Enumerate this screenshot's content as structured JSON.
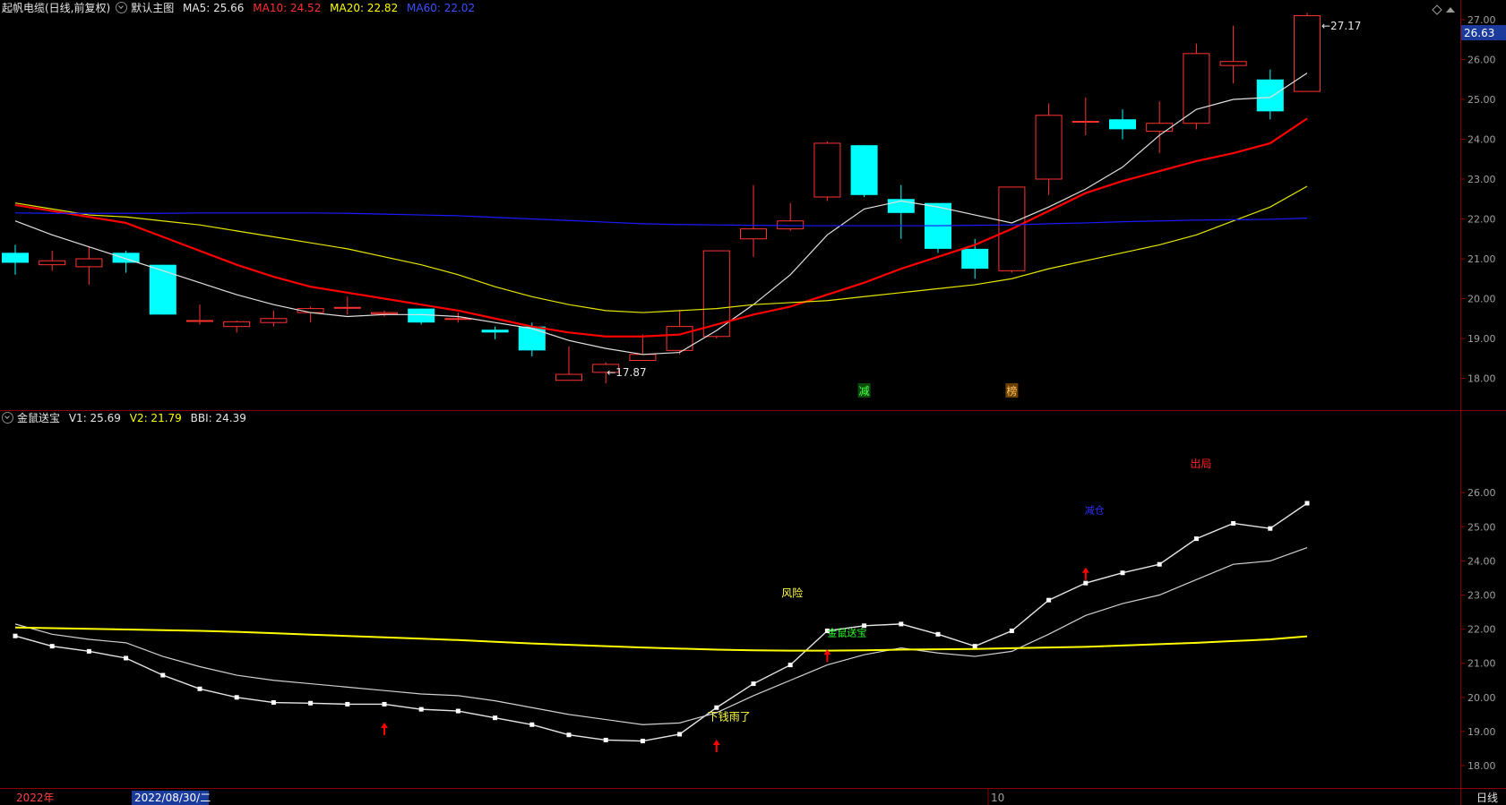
{
  "header": {
    "stock": "起帆电缆(日线,前复权)",
    "main_view": "默认主图",
    "ma5": "MA5: 25.66",
    "ma10": "MA10: 24.52",
    "ma20": "MA20: 22.82",
    "ma60": "MA60: 22.02"
  },
  "indicator_header": {
    "name": "金鼠送宝",
    "v1": "V1: 25.69",
    "v2": "V2: 21.79",
    "bbi": "BBI: 24.39"
  },
  "price_badge": "26.63",
  "high_label": "27.17",
  "low_label": "17.87",
  "markers": {
    "jian": "减",
    "bang": "榜"
  },
  "signals": {
    "xiaqian": "下钱雨了",
    "fengxian": "风险",
    "jinshu": "金鼠送宝",
    "jiancang": "减仓",
    "chuju": "出局"
  },
  "bottom_axis": {
    "year": "2022年",
    "cursor_date": "2022/08/30/二",
    "month": "10",
    "period": "日线"
  },
  "colors": {
    "up": "#ff3232",
    "down": "#00ffff",
    "ma5": "#ffffff",
    "ma10": "#ff0000",
    "ma20": "#ffff00",
    "ma60": "#0000ff"
  },
  "chart_data": [
    {
      "type": "candlestick",
      "title": "起帆电缆(日线,前复权)",
      "ylim": [
        17.6,
        27.3
      ],
      "y_ticks": [
        18,
        19,
        20,
        21,
        22,
        23,
        24,
        25,
        26,
        27
      ],
      "candles": [
        {
          "o": 21.15,
          "c": 20.9,
          "h": 21.35,
          "l": 20.6
        },
        {
          "o": 20.85,
          "c": 20.95,
          "h": 21.2,
          "l": 20.7
        },
        {
          "o": 20.8,
          "c": 21.0,
          "h": 21.3,
          "l": 20.35
        },
        {
          "o": 21.15,
          "c": 20.9,
          "h": 21.2,
          "l": 20.65
        },
        {
          "o": 20.85,
          "c": 19.6,
          "h": 20.85,
          "l": 19.6
        },
        {
          "o": 19.45,
          "c": 19.45,
          "h": 19.85,
          "l": 19.35
        },
        {
          "o": 19.3,
          "c": 19.42,
          "h": 19.45,
          "l": 19.15
        },
        {
          "o": 19.4,
          "c": 19.5,
          "h": 19.7,
          "l": 19.3
        },
        {
          "o": 19.65,
          "c": 19.75,
          "h": 19.8,
          "l": 19.4
        },
        {
          "o": 19.78,
          "c": 19.78,
          "h": 20.05,
          "l": 19.6
        },
        {
          "o": 19.62,
          "c": 19.65,
          "h": 19.7,
          "l": 19.55
        },
        {
          "o": 19.75,
          "c": 19.4,
          "h": 19.75,
          "l": 19.35
        },
        {
          "o": 19.5,
          "c": 19.5,
          "h": 19.65,
          "l": 19.4
        },
        {
          "o": 19.22,
          "c": 19.15,
          "h": 19.3,
          "l": 18.98
        },
        {
          "o": 19.3,
          "c": 18.7,
          "h": 19.4,
          "l": 18.55
        },
        {
          "o": 17.95,
          "c": 18.1,
          "h": 18.8,
          "l": 17.95
        },
        {
          "o": 18.15,
          "c": 18.35,
          "h": 18.4,
          "l": 17.87
        },
        {
          "o": 18.45,
          "c": 18.6,
          "h": 19.1,
          "l": 18.45
        },
        {
          "o": 18.7,
          "c": 19.3,
          "h": 19.7,
          "l": 18.6
        },
        {
          "o": 19.05,
          "c": 21.2,
          "h": 21.2,
          "l": 19.0
        },
        {
          "o": 21.5,
          "c": 21.75,
          "h": 22.85,
          "l": 21.05
        },
        {
          "o": 21.75,
          "c": 21.95,
          "h": 22.4,
          "l": 21.7
        },
        {
          "o": 22.55,
          "c": 23.9,
          "h": 23.95,
          "l": 22.45
        },
        {
          "o": 23.85,
          "c": 22.6,
          "h": 23.85,
          "l": 22.55
        },
        {
          "o": 22.5,
          "c": 22.15,
          "h": 22.85,
          "l": 21.5
        },
        {
          "o": 22.4,
          "c": 21.25,
          "h": 22.4,
          "l": 21.15
        },
        {
          "o": 21.25,
          "c": 20.75,
          "h": 21.5,
          "l": 20.5
        },
        {
          "o": 20.7,
          "c": 22.8,
          "h": 22.8,
          "l": 20.65
        },
        {
          "o": 23.0,
          "c": 24.6,
          "h": 24.9,
          "l": 22.6
        },
        {
          "o": 24.45,
          "c": 24.45,
          "h": 25.05,
          "l": 24.1
        },
        {
          "o": 24.5,
          "c": 24.25,
          "h": 24.75,
          "l": 24.0
        },
        {
          "o": 24.2,
          "c": 24.4,
          "h": 24.95,
          "l": 23.65
        },
        {
          "o": 24.4,
          "c": 26.15,
          "h": 26.4,
          "l": 24.25
        },
        {
          "o": 25.85,
          "c": 25.95,
          "h": 26.85,
          "l": 25.4
        },
        {
          "o": 25.5,
          "c": 24.7,
          "h": 25.75,
          "l": 24.5
        },
        {
          "o": 25.2,
          "c": 27.1,
          "h": 27.17,
          "l": 25.2
        }
      ],
      "series": [
        {
          "name": "MA5",
          "values": [
            21.95,
            21.6,
            21.3,
            21.0,
            20.7,
            20.4,
            20.1,
            19.85,
            19.65,
            19.55,
            19.6,
            19.6,
            19.55,
            19.4,
            19.25,
            18.95,
            18.75,
            18.6,
            18.65,
            19.2,
            19.85,
            20.6,
            21.6,
            22.25,
            22.45,
            22.3,
            22.1,
            21.9,
            22.3,
            22.75,
            23.3,
            24.1,
            24.75,
            25.0,
            25.05,
            25.66
          ]
        },
        {
          "name": "MA10",
          "values": [
            22.35,
            22.2,
            22.05,
            21.9,
            21.55,
            21.2,
            20.85,
            20.55,
            20.3,
            20.15,
            20.0,
            19.85,
            19.7,
            19.5,
            19.3,
            19.15,
            19.05,
            19.05,
            19.1,
            19.35,
            19.6,
            19.8,
            20.1,
            20.4,
            20.75,
            21.05,
            21.35,
            21.75,
            22.2,
            22.65,
            22.95,
            23.2,
            23.45,
            23.65,
            23.9,
            24.52
          ]
        },
        {
          "name": "MA20",
          "values": [
            22.4,
            22.25,
            22.1,
            22.05,
            21.95,
            21.85,
            21.7,
            21.55,
            21.4,
            21.25,
            21.05,
            20.85,
            20.6,
            20.3,
            20.05,
            19.85,
            19.7,
            19.65,
            19.7,
            19.75,
            19.85,
            19.9,
            19.95,
            20.05,
            20.15,
            20.25,
            20.35,
            20.5,
            20.75,
            20.95,
            21.15,
            21.35,
            21.6,
            21.95,
            22.3,
            22.82
          ]
        },
        {
          "name": "MA60",
          "values": [
            22.15,
            22.14,
            22.14,
            22.14,
            22.14,
            22.15,
            22.15,
            22.15,
            22.15,
            22.14,
            22.12,
            22.1,
            22.08,
            22.04,
            22.0,
            21.96,
            21.92,
            21.88,
            21.86,
            21.85,
            21.84,
            21.83,
            21.83,
            21.83,
            21.83,
            21.83,
            21.84,
            21.85,
            21.88,
            21.9,
            21.93,
            21.95,
            21.97,
            21.98,
            21.99,
            22.02
          ]
        }
      ]
    },
    {
      "type": "line",
      "title": "金鼠送宝",
      "ylim": [
        17.6,
        27.6
      ],
      "y_ticks": [
        18,
        19,
        20,
        21,
        22,
        23,
        24,
        25,
        26
      ],
      "series": [
        {
          "name": "V1",
          "values": [
            21.8,
            21.5,
            21.35,
            21.15,
            20.65,
            20.25,
            20.0,
            19.85,
            19.83,
            19.8,
            19.8,
            19.65,
            19.6,
            19.4,
            19.2,
            18.9,
            18.75,
            18.72,
            18.92,
            19.7,
            20.4,
            20.95,
            21.95,
            22.1,
            22.15,
            21.85,
            21.5,
            21.95,
            22.85,
            23.35,
            23.65,
            23.9,
            24.65,
            25.1,
            24.95,
            25.69
          ]
        },
        {
          "name": "BBI",
          "values": [
            22.15,
            21.85,
            21.7,
            21.6,
            21.2,
            20.9,
            20.65,
            20.5,
            20.4,
            20.3,
            20.2,
            20.1,
            20.05,
            19.9,
            19.7,
            19.5,
            19.35,
            19.2,
            19.25,
            19.55,
            20.05,
            20.5,
            20.95,
            21.25,
            21.45,
            21.3,
            21.2,
            21.35,
            21.85,
            22.4,
            22.75,
            23.0,
            23.45,
            23.9,
            24.0,
            24.39
          ]
        },
        {
          "name": "V2",
          "values": [
            22.05,
            22.03,
            22.01,
            21.99,
            21.97,
            21.95,
            21.92,
            21.88,
            21.84,
            21.8,
            21.76,
            21.72,
            21.68,
            21.63,
            21.58,
            21.54,
            21.5,
            21.46,
            21.43,
            21.4,
            21.38,
            21.37,
            21.37,
            21.38,
            21.4,
            21.41,
            21.42,
            21.44,
            21.46,
            21.48,
            21.52,
            21.56,
            21.6,
            21.65,
            21.7,
            21.79
          ]
        }
      ]
    }
  ]
}
